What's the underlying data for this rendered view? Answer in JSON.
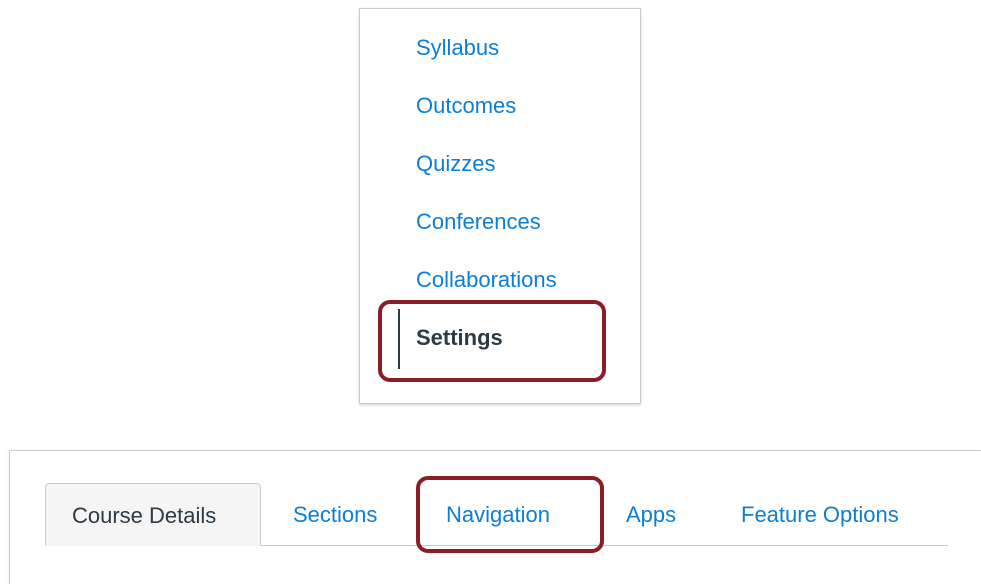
{
  "course_nav": {
    "items": [
      {
        "label": "Syllabus"
      },
      {
        "label": "Outcomes"
      },
      {
        "label": "Quizzes"
      },
      {
        "label": "Conferences"
      },
      {
        "label": "Collaborations"
      },
      {
        "label": "Settings"
      }
    ],
    "active_index": 5
  },
  "settings_tabs": {
    "tabs": [
      {
        "label": "Course Details"
      },
      {
        "label": "Sections"
      },
      {
        "label": "Navigation"
      },
      {
        "label": "Apps"
      },
      {
        "label": "Feature Options"
      }
    ],
    "active_index": 0
  },
  "colors": {
    "link": "#0b7ed6",
    "active_text": "#2d3b45",
    "highlight": "#8b1e24",
    "border": "#c7cdd1"
  }
}
